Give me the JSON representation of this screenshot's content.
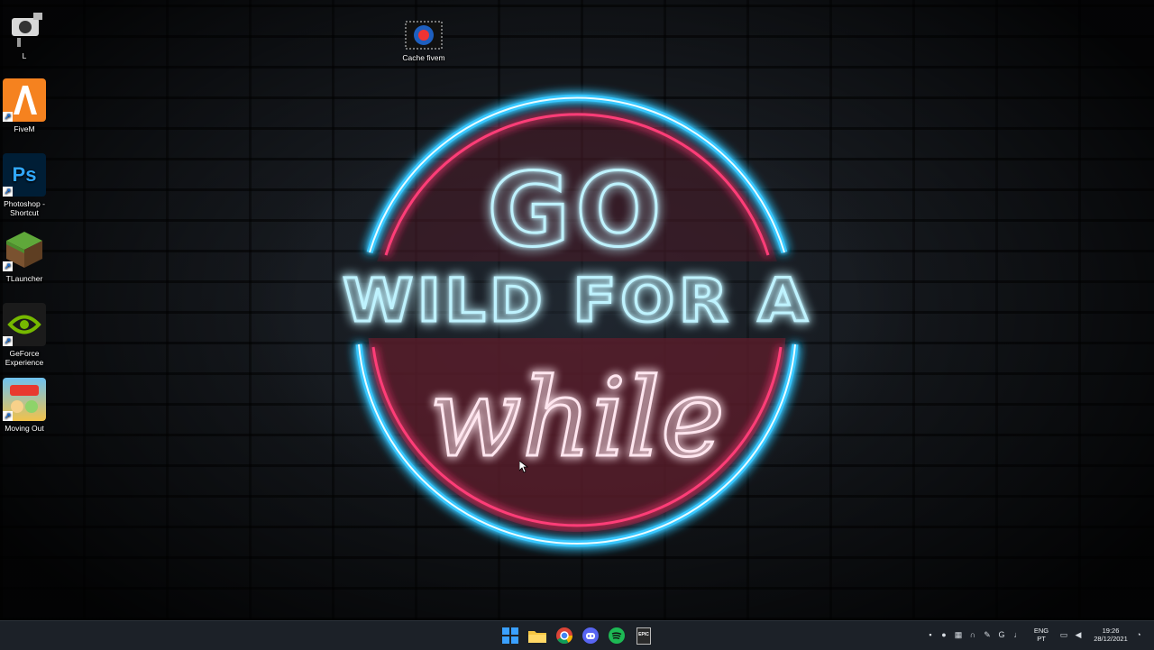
{
  "wallpaper": {
    "line1": "GO",
    "line2": "WILD FOR A",
    "line3": "while",
    "colors": {
      "blue_neon": "#39c8ff",
      "pink_neon": "#ff3d78",
      "fill_red": "#6a2230"
    }
  },
  "desktop": {
    "icons": [
      {
        "label": "L",
        "icon": "camera-icon"
      },
      {
        "label": "FiveM",
        "icon": "fivem-icon"
      },
      {
        "label": "Photoshop - Shortcut",
        "icon": "photoshop-icon",
        "glyph": "Ps"
      },
      {
        "label": "TLauncher",
        "icon": "minecraft-block-icon"
      },
      {
        "label": "GeForce Experience",
        "icon": "nvidia-icon"
      },
      {
        "label": "Moving Out",
        "icon": "moving-out-game-icon"
      },
      {
        "label": "Cache fivem",
        "icon": "fivem-cache-icon"
      }
    ]
  },
  "taskbar": {
    "apps": [
      {
        "name": "Start",
        "icon": "windows-start-icon"
      },
      {
        "name": "File Explorer",
        "icon": "folder-icon"
      },
      {
        "name": "Chrome",
        "icon": "chrome-icon"
      },
      {
        "name": "Discord",
        "icon": "discord-icon"
      },
      {
        "name": "Spotify",
        "icon": "spotify-icon"
      },
      {
        "name": "Epic Games",
        "icon": "epic-games-icon",
        "glyph": "EPIC"
      }
    ],
    "tray": {
      "language": "ENG",
      "region": "PT",
      "time": "19:26",
      "date": "28/12/2021"
    }
  }
}
